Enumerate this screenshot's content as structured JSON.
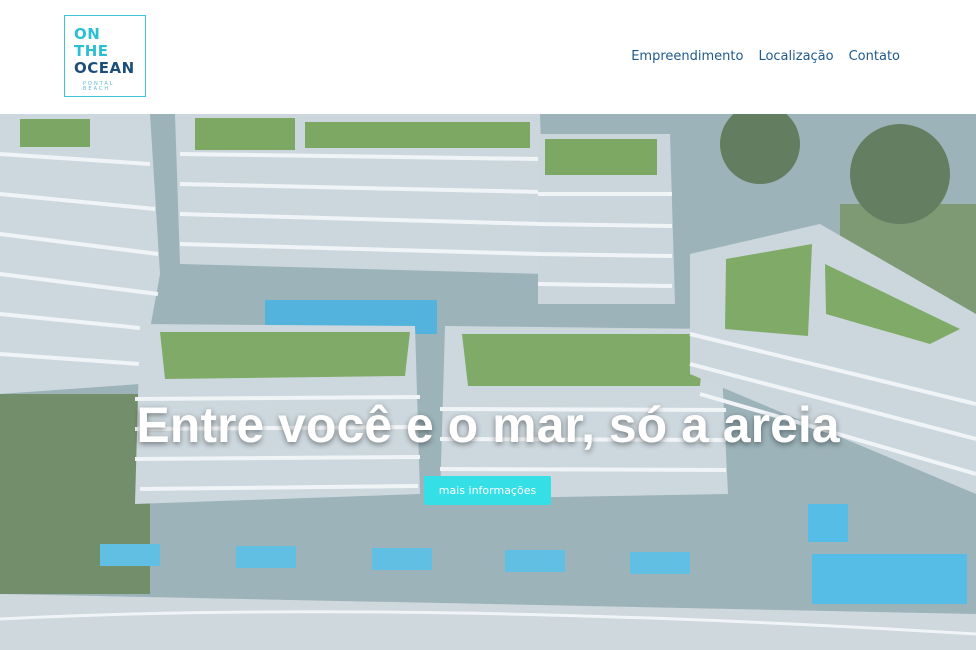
{
  "logo": {
    "line1": "ON",
    "line2": "THE",
    "line3": "OCEAN",
    "tagline": "PONTAL BEACH"
  },
  "nav": {
    "items": [
      "Empreendimento",
      "Localização",
      "Contato"
    ]
  },
  "hero": {
    "headline": "Entre você e o mar, só a areia",
    "button_label": "mais informações"
  },
  "colors": {
    "logo_cyan": "#2bbfd3",
    "logo_navy": "#1d4d7a",
    "nav_text": "#1e5a8e",
    "button": "#34dfe6"
  }
}
